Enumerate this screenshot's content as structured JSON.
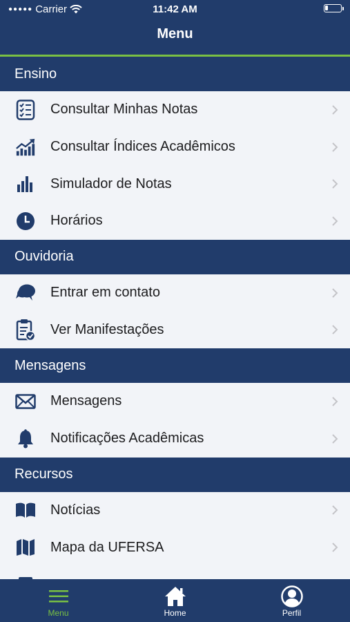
{
  "status": {
    "carrier": "Carrier",
    "time": "11:42 AM"
  },
  "header": {
    "title": "Menu"
  },
  "sections": [
    {
      "title": "Ensino",
      "items": [
        {
          "label": "Consultar Minhas Notas",
          "icon": "checklist-icon"
        },
        {
          "label": "Consultar Índices Acadêmicos",
          "icon": "trend-chart-icon"
        },
        {
          "label": "Simulador de Notas",
          "icon": "bar-chart-icon"
        },
        {
          "label": "Horários",
          "icon": "clock-icon"
        }
      ]
    },
    {
      "title": "Ouvidoria",
      "items": [
        {
          "label": "Entrar em contato",
          "icon": "chat-bubbles-icon"
        },
        {
          "label": "Ver Manifestações",
          "icon": "clipboard-check-icon"
        }
      ]
    },
    {
      "title": "Mensagens",
      "items": [
        {
          "label": "Mensagens",
          "icon": "envelope-icon"
        },
        {
          "label": "Notificações Acadêmicas",
          "icon": "bell-icon"
        }
      ]
    },
    {
      "title": "Recursos",
      "items": [
        {
          "label": "Notícias",
          "icon": "book-icon"
        },
        {
          "label": "Mapa da UFERSA",
          "icon": "map-icon"
        }
      ]
    }
  ],
  "tabbar": [
    {
      "label": "Menu",
      "icon": "hamburger-icon",
      "active": true
    },
    {
      "label": "Home",
      "icon": "home-icon",
      "active": false
    },
    {
      "label": "Perfil",
      "icon": "profile-icon",
      "active": false
    }
  ],
  "colors": {
    "primary": "#213c6b",
    "accent": "#7ac143",
    "background": "#f2f4f8"
  }
}
